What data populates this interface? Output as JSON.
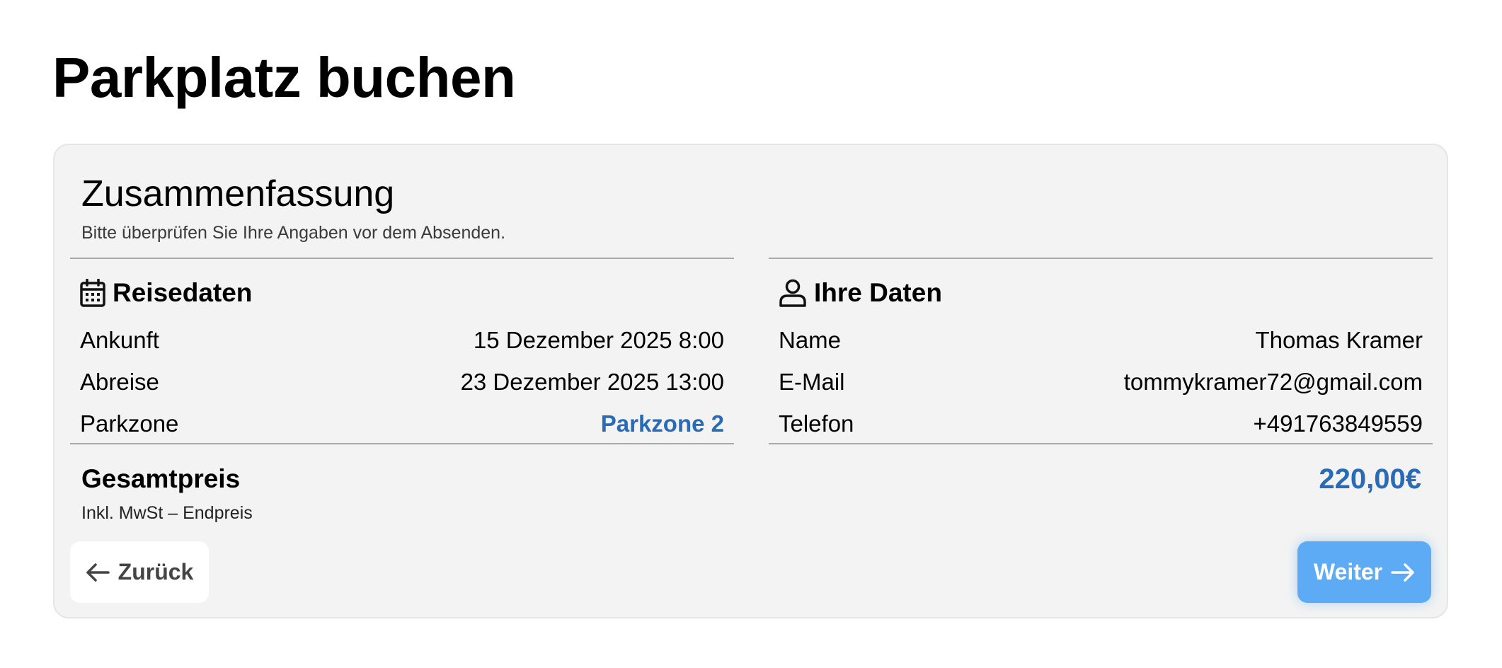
{
  "page": {
    "title": "Parkplatz buchen"
  },
  "summary": {
    "title": "Zusammenfassung",
    "subtitle": "Bitte überprüfen Sie Ihre Angaben vor dem Absenden."
  },
  "travel": {
    "title": "Reisedaten",
    "icon": "calendar-icon",
    "rows": [
      {
        "label": "Ankunft",
        "value": "15 Dezember 2025 8:00"
      },
      {
        "label": "Abreise",
        "value": "23 Dezember 2025 13:00"
      },
      {
        "label": "Parkzone",
        "value": "Parkzone 2"
      }
    ]
  },
  "personal": {
    "title": "Ihre Daten",
    "icon": "user-icon",
    "rows": [
      {
        "label": "Name",
        "value": "Thomas Kramer"
      },
      {
        "label": "E-Mail",
        "value": "tommykramer72@gmail.com"
      },
      {
        "label": "Telefon",
        "value": "+491763849559"
      }
    ]
  },
  "total": {
    "label": "Gesamtpreis",
    "note": "Inkl. MwSt – Endpreis",
    "value": "220,00€"
  },
  "buttons": {
    "back_label": "Zurück",
    "next_label": "Weiter"
  },
  "colors": {
    "accent": "#2a6bb5",
    "primary_button": "#5eabf5",
    "card_background": "#f3f3f3"
  }
}
